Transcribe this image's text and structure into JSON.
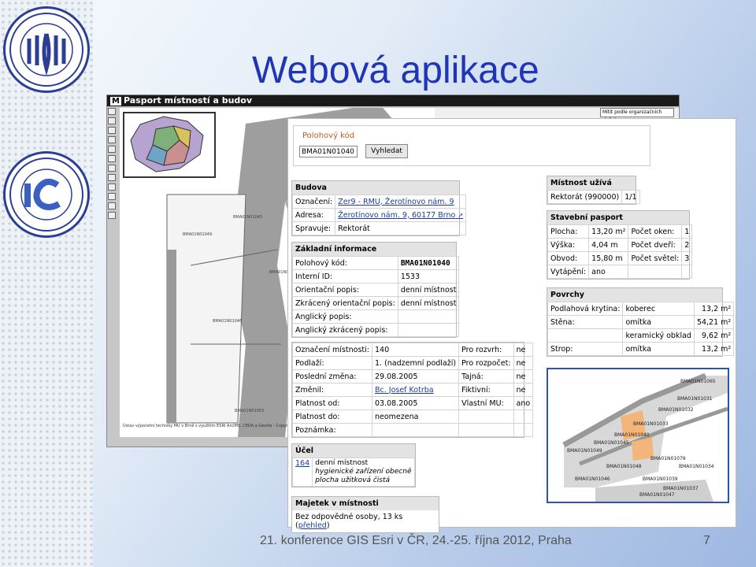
{
  "slide": {
    "title": "Webová aplikace",
    "footer": "21. konference GIS Esri v ČR, 24.-25. října 2012, Praha",
    "page": "7"
  },
  "logos": {
    "top": "UNIVERSITAS MASARYKIANA BRUNENSIS",
    "bottom": "INSTITUTE OF COMPUTER SCIENCE MASARYK UNIVERSITY"
  },
  "back_window": {
    "title": "Pasport místností a budov",
    "title_logo": "M",
    "layer_select": "Mítit podle organizačních složek",
    "footer": "Ústav výpočetní techniky MU v Brně s využitím ESRI ArcIMS, CEDA a Geodis - Copyright (C) 20",
    "room_labels": [
      "BMA01N01045",
      "BMA01N01049",
      "BMA01N01046",
      "BMA01N01003",
      "BMA01N0"
    ]
  },
  "search": {
    "legend": "Polohový kód",
    "value": "BMA01N01040",
    "button": "Vyhledat"
  },
  "budova": {
    "title": "Budova",
    "rows": [
      {
        "label": "Označení:",
        "value": "Zer9 - RMU, Žerotínovo nám. 9",
        "link": true
      },
      {
        "label": "Adresa:",
        "value": "Žerotínovo nám. 9, 60177 Brno",
        "link": true
      },
      {
        "label": "Spravuje:",
        "value": "Rektorát",
        "link": false
      }
    ]
  },
  "zakladni": {
    "title": "Základní informace",
    "rows": [
      {
        "label": "Polohový kód:",
        "value": "BMA01N01040",
        "bold": true
      },
      {
        "label": "Interní ID:",
        "value": "1533"
      },
      {
        "label": "Orientační popis:",
        "value": "denní místnost"
      },
      {
        "label": "Zkrácený orientační popis:",
        "value": "denní místnost"
      },
      {
        "label": "Anglický popis:",
        "value": ""
      },
      {
        "label": "Anglický zkrácený popis:",
        "value": ""
      }
    ]
  },
  "mistnost": {
    "rows": [
      [
        "Označení místnosti:",
        "140",
        "Pro rozvrh:",
        "ne"
      ],
      [
        "Podlaží:",
        "1. (nadzemní podlaží)",
        "Pro rozpočet:",
        "ne"
      ],
      [
        "Poslední změna:",
        "29.08.2005",
        "Tajná:",
        "ne"
      ],
      [
        "Změnil:",
        "Bc. Josef Kotrba",
        "Fiktivní:",
        "ne"
      ],
      [
        "Platnost od:",
        "03.08.2005",
        "Vlastní MU:",
        "ano"
      ],
      [
        "Platnost do:",
        "neomezena",
        "",
        ""
      ],
      [
        "Poznámka:",
        "",
        "",
        ""
      ]
    ]
  },
  "ucel": {
    "title": "Účel",
    "code": "164",
    "lines": [
      "denní místnost",
      "hygienické zařízení obecně",
      "plocha užitková čistá"
    ]
  },
  "majetek": {
    "title": "Majetek v místnosti",
    "text": "Bez odpovědné osoby, 13 ks (",
    "link": "přehled",
    "end": ")"
  },
  "uziva": {
    "title": "Místnost užívá",
    "unit": "Rektorát (990000)",
    "share": "1/1"
  },
  "stavebni": {
    "title": "Stavební pasport",
    "rows": [
      [
        "Plocha:",
        "13,20 m²",
        "Počet oken:",
        "1"
      ],
      [
        "Výška:",
        "4,04 m",
        "Počet dveří:",
        "2"
      ],
      [
        "Obvod:",
        "15,80 m",
        "Počet světel:",
        "3"
      ]
    ],
    "vytapeni_label": "Vytápění:",
    "vytapeni": "ano"
  },
  "povrchy": {
    "title": "Povrchy",
    "rows": [
      [
        "Podlahová krytina:",
        "koberec",
        "13,2 m²"
      ],
      [
        "Stěna:",
        "omítka",
        "54,21 m²"
      ],
      [
        "",
        "keramický obklad",
        "9,62 m²"
      ],
      [
        "Strop:",
        "omítka",
        "13,2 m²"
      ]
    ]
  },
  "plan_labels": [
    "BMA01N01065",
    "BMA01N01031",
    "BMA01N01032",
    "BMA01N01033",
    "BMA01N01040",
    "BMA01N01045",
    "BMA01N01049",
    "BMA01N01079",
    "BMA01N01048",
    "BMA01N01034",
    "BMA01N01046",
    "BMA01N01039",
    "BMA01N01037",
    "BMA01N01047"
  ],
  "colors": {
    "title": "#1f35b5",
    "highlight": "#f4b57a",
    "frame": "#2c55a8"
  }
}
